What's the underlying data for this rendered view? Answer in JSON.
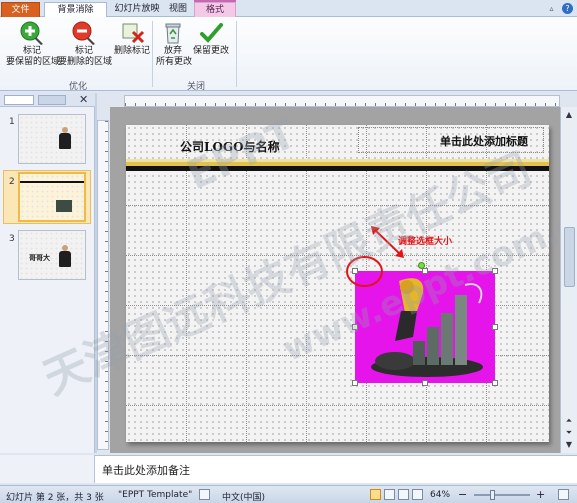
{
  "ribbon_tabs": {
    "file": "文件",
    "background_removal": "背景消除",
    "slideshow": "幻灯片放映",
    "view": "视图",
    "format": "格式"
  },
  "ribbon": {
    "mark_keep_line1": "标记",
    "mark_keep_line2": "要保留的区域",
    "mark_remove_line1": "标记",
    "mark_remove_line2": "要删除的区域",
    "delete_mark": "删除标记",
    "discard_line1": "放弃",
    "discard_line2": "所有更改",
    "keep_changes": "保留更改",
    "group_refine": "优化",
    "group_close": "关闭"
  },
  "slides_panel": {
    "numbers": [
      "1",
      "2",
      "3"
    ],
    "thumb3_caption": "哥哥大"
  },
  "slide": {
    "logo_title": "公司LOGO与名称",
    "title_placeholder": "单击此处添加标题",
    "annotation": "调整选框大小"
  },
  "watermarks": [
    "EPPT",
    "天津图远科技有限责任公司",
    "www.eppt.com.cn"
  ],
  "notes": {
    "placeholder": "单击此处添加备注"
  },
  "status_bar": {
    "slide_info": "幻灯片 第 2 张，共 3 张",
    "theme": "\"EPPT Template\"",
    "language": "中文(中国)",
    "zoom": "64%",
    "zoom_out": "−",
    "zoom_in": "+"
  },
  "colors": {
    "file_tab": "#d9601e",
    "picture_bg": "#e414ea",
    "annotation": "#e0151a",
    "band_yellow": "#e3c14e"
  },
  "icons": {
    "mark_keep": "plus-pen-icon",
    "mark_remove": "minus-pen-icon",
    "delete_mark": "x-pen-icon",
    "discard": "recycle-icon",
    "keep": "checkmark-icon"
  }
}
